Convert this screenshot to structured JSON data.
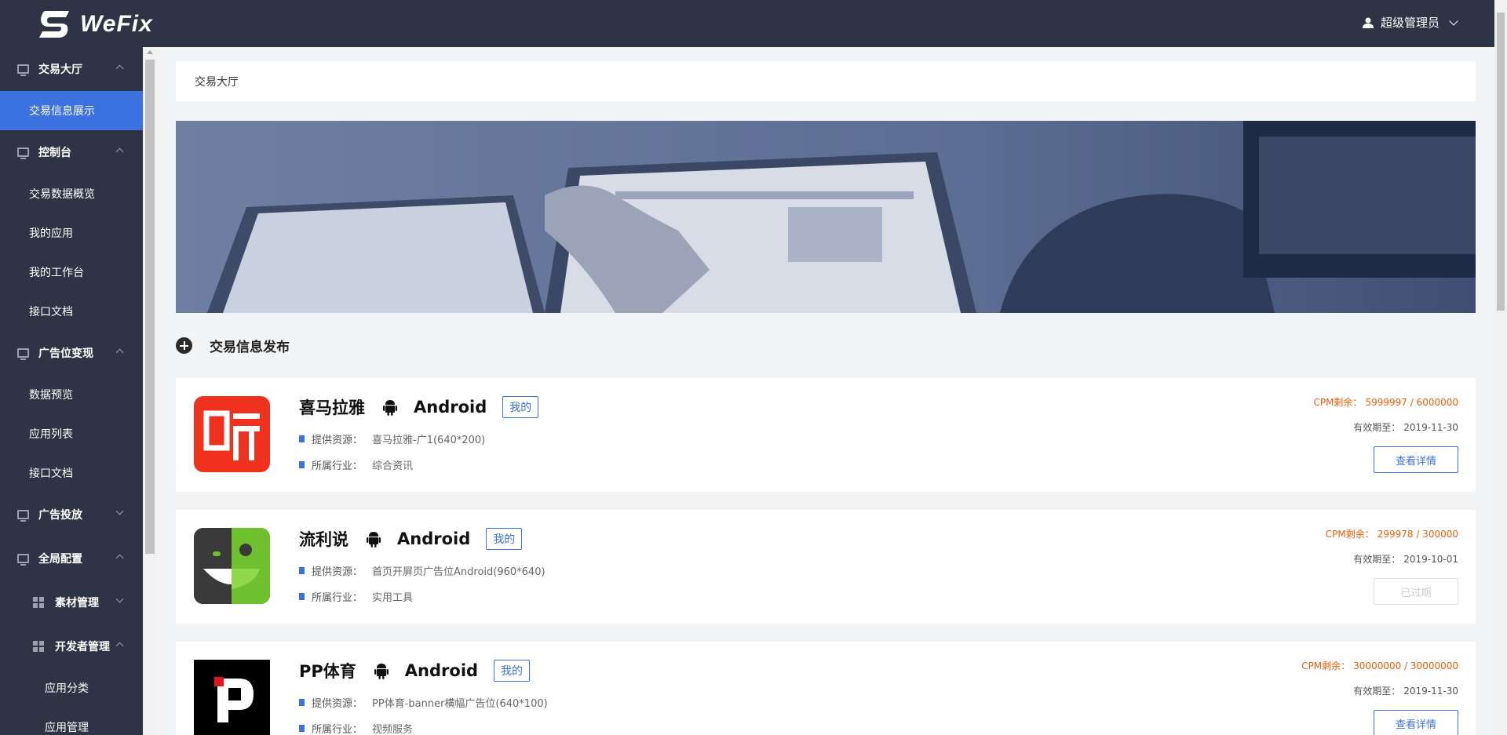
{
  "header": {
    "logo_text": "WeFix",
    "user_name": "超级管理员"
  },
  "sidebar": {
    "groups": [
      {
        "label": "交易大厅",
        "items": [
          "交易信息展示"
        ]
      },
      {
        "label": "控制台",
        "items": [
          "交易数据概览",
          "我的应用",
          "我的工作台",
          "接口文档"
        ]
      },
      {
        "label": "广告位变现",
        "items": [
          "数据预览",
          "应用列表",
          "接口文档"
        ]
      },
      {
        "label": "广告投放",
        "items": []
      },
      {
        "label": "全局配置",
        "items": []
      }
    ],
    "sub_groups": [
      {
        "label": "素材管理",
        "items": []
      },
      {
        "label": "开发者管理",
        "items": [
          "应用分类",
          "应用管理"
        ]
      }
    ]
  },
  "breadcrumb": "交易大厅",
  "section_title": "交易信息发布",
  "cards": [
    {
      "app_name": "喜马拉雅",
      "platform": "Android",
      "tag": "我的",
      "resource_label": "提供资源：",
      "resource_value": "喜马拉雅-广1(640*200)",
      "industry_label": "所属行业：",
      "industry_value": "综合资讯",
      "cpm_label": "CPM剩余：",
      "cpm_value": "5999997 / 6000000",
      "valid_label": "有效期至：",
      "valid_value": "2019-11-30",
      "button": "查看详情",
      "expired": false,
      "logo_text": "听"
    },
    {
      "app_name": "流利说",
      "platform": "Android",
      "tag": "我的",
      "resource_label": "提供资源：",
      "resource_value": "首页开屏页广告位Android(960*640)",
      "industry_label": "所属行业：",
      "industry_value": "实用工具",
      "cpm_label": "CPM剩余：",
      "cpm_value": "299978 / 300000",
      "valid_label": "有效期至：",
      "valid_value": "2019-10-01",
      "button": "已过期",
      "expired": true,
      "logo_text": ""
    },
    {
      "app_name": "PP体育",
      "platform": "Android",
      "tag": "我的",
      "resource_label": "提供资源：",
      "resource_value": "PP体育-banner横幅广告位(640*100)",
      "industry_label": "所属行业：",
      "industry_value": "视频服务",
      "cpm_label": "CPM剩余：",
      "cpm_value": "30000000 / 30000000",
      "valid_label": "有效期至：",
      "valid_value": "2019-11-30",
      "button": "查看详情",
      "expired": false,
      "logo_text": ""
    }
  ],
  "colors": {
    "header_bg": "#2e3445",
    "accent": "#3b72e0",
    "cpm": "#e8600a"
  }
}
